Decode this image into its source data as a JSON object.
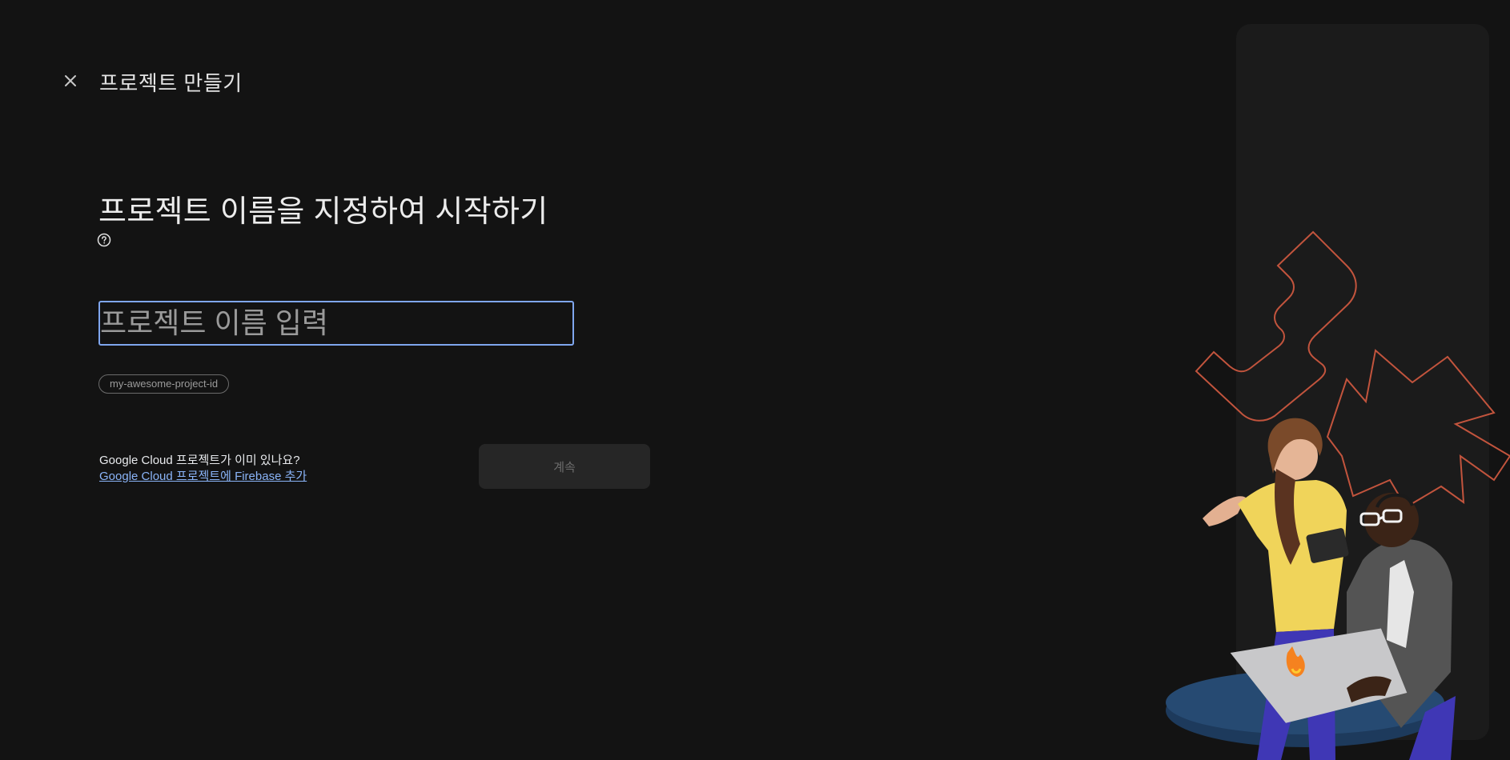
{
  "header": {
    "title": "프로젝트 만들기",
    "close_icon": "close-icon"
  },
  "main": {
    "headline": "프로젝트 이름을 지정하여 시작하기",
    "help_icon": "help-circle-icon",
    "name_input": {
      "placeholder": "프로젝트 이름 입력",
      "value": ""
    },
    "project_id_chip": "my-awesome-project-id",
    "existing_question": "Google Cloud 프로젝트가 이미 있나요?",
    "existing_link": "Google Cloud 프로젝트에 Firebase 추가",
    "continue_label": "계속"
  },
  "colors": {
    "background": "#131313",
    "accent_border": "#7fa6ee",
    "link": "#8ab4f8",
    "illustration_outline": "#c2543d"
  }
}
